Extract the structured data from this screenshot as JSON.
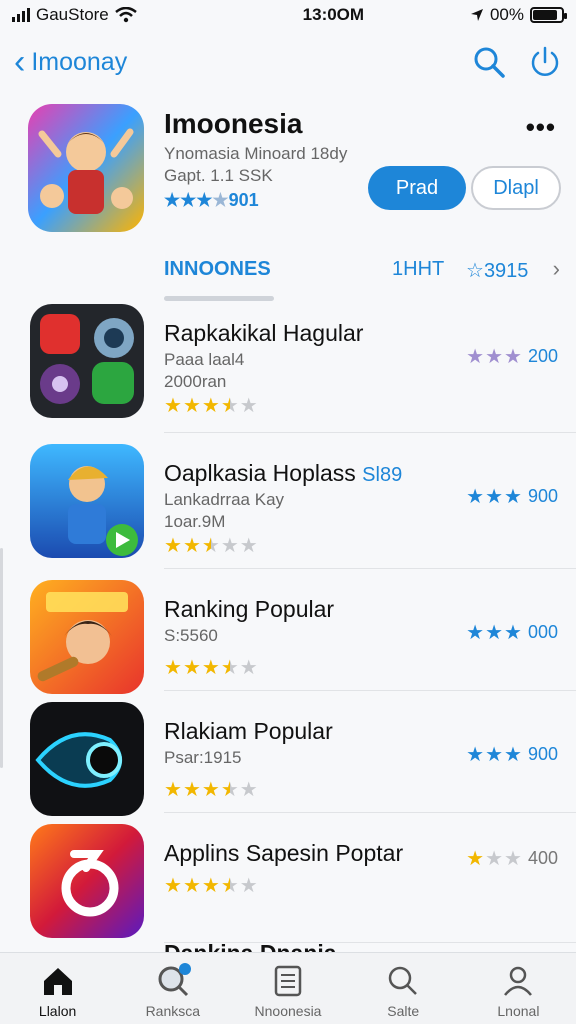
{
  "status": {
    "carrier": "GauStore",
    "time": "13:0OM",
    "battery": "00%",
    "battery_level": 0.85
  },
  "nav": {
    "back_label": "Imoonay"
  },
  "featured": {
    "title": "Imoonesia",
    "subtitle": "Ynomasia Minoard 18dy",
    "subtitle2": "Gapt. 1.1 SSK",
    "rating_text": "901",
    "stars": 3,
    "primary_button": "Prad",
    "secondary_button": "Dlapl"
  },
  "section": {
    "title": "INNOONES",
    "mid": "1HHT",
    "right": "3915"
  },
  "apps": [
    {
      "name": "Rapkakikal Hagular",
      "meta1": "Paaa laal4",
      "meta2": "2000ran",
      "stars": 3.5,
      "rank_stars": 3,
      "rank_color": "#a08fd0",
      "rank_value": "200"
    },
    {
      "name": "Oaplkasia Hoplass",
      "name_suffix": "Sl89",
      "meta1": "Lankadrraa Kay",
      "meta2": "1oar.9M",
      "stars": 2.5,
      "rank_stars": 3,
      "rank_color": "#1e86d8",
      "rank_value": "900"
    },
    {
      "name": "Ranking Popular",
      "meta1": "S:5560",
      "meta2": "",
      "stars": 3.5,
      "rank_stars": 3,
      "rank_color": "#1e86d8",
      "rank_value": "000"
    },
    {
      "name": "Rlakiam Popular",
      "meta1": "Psar:1915",
      "meta2": "",
      "stars": 3.5,
      "rank_stars": 3,
      "rank_color": "#1e86d8",
      "rank_value": "900"
    },
    {
      "name": "Applins Sapesin Poptar",
      "meta1": "",
      "meta2": "",
      "stars": 3.5,
      "rank_stars": 1,
      "rank_color": "#f2b700",
      "rank_value": "400"
    }
  ],
  "partial_row": {
    "name": "Dankina Dnania"
  },
  "tabs": [
    {
      "label": "Llalon",
      "icon": "home-icon",
      "active": true
    },
    {
      "label": "Ranksca",
      "icon": "search-badge-icon",
      "active": false
    },
    {
      "label": "Nnoonesia",
      "icon": "list-icon",
      "active": false
    },
    {
      "label": "Salte",
      "icon": "search-icon",
      "active": false
    },
    {
      "label": "Lnonal",
      "icon": "person-icon",
      "active": false
    }
  ],
  "colors": {
    "accent": "#1e86d8",
    "star_gold": "#f2b700",
    "star_gray": "#c7c9cd"
  }
}
